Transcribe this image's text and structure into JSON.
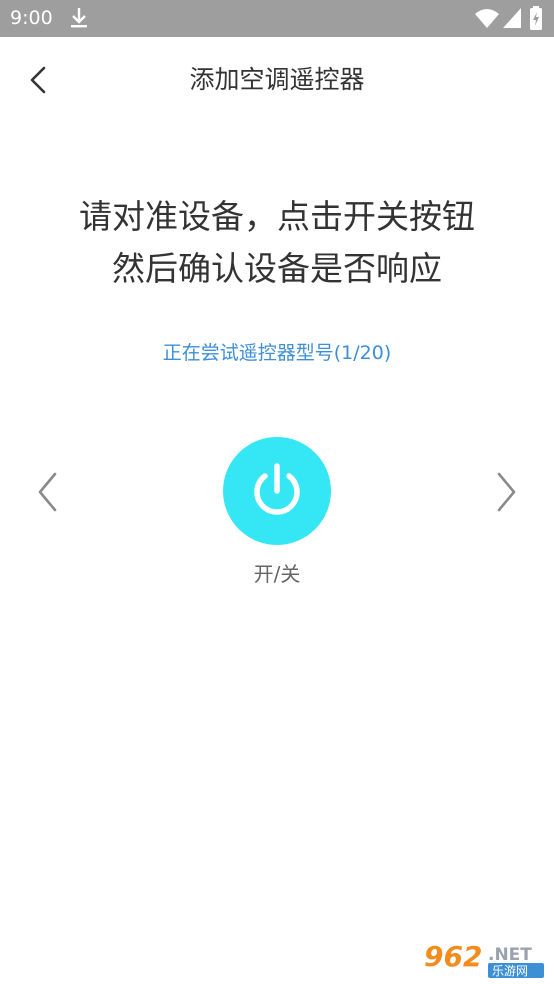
{
  "status_bar": {
    "time": "9:00",
    "icons": [
      "download-icon",
      "wifi-icon",
      "signal-icon",
      "battery-icon"
    ]
  },
  "header": {
    "title": "添加空调遥控器",
    "back_icon": "chevron-left-icon"
  },
  "main": {
    "instruction_line1": "请对准设备，点击开关按钮",
    "instruction_line2": "然后确认设备是否响应",
    "model_status": "正在尝试遥控器型号(1/20)",
    "power_label": "开/关",
    "prev_icon": "chevron-left-icon",
    "next_icon": "chevron-right-icon",
    "power_icon": "power-icon"
  },
  "watermark": {
    "brand": "962.NET",
    "subtitle": "乐游网"
  },
  "colors": {
    "status_bar_bg": "#9e9e9e",
    "accent_blue": "#3d8fd6",
    "power_button_bg": "#35e6f4",
    "text_primary": "#333333",
    "text_secondary": "#666666"
  }
}
